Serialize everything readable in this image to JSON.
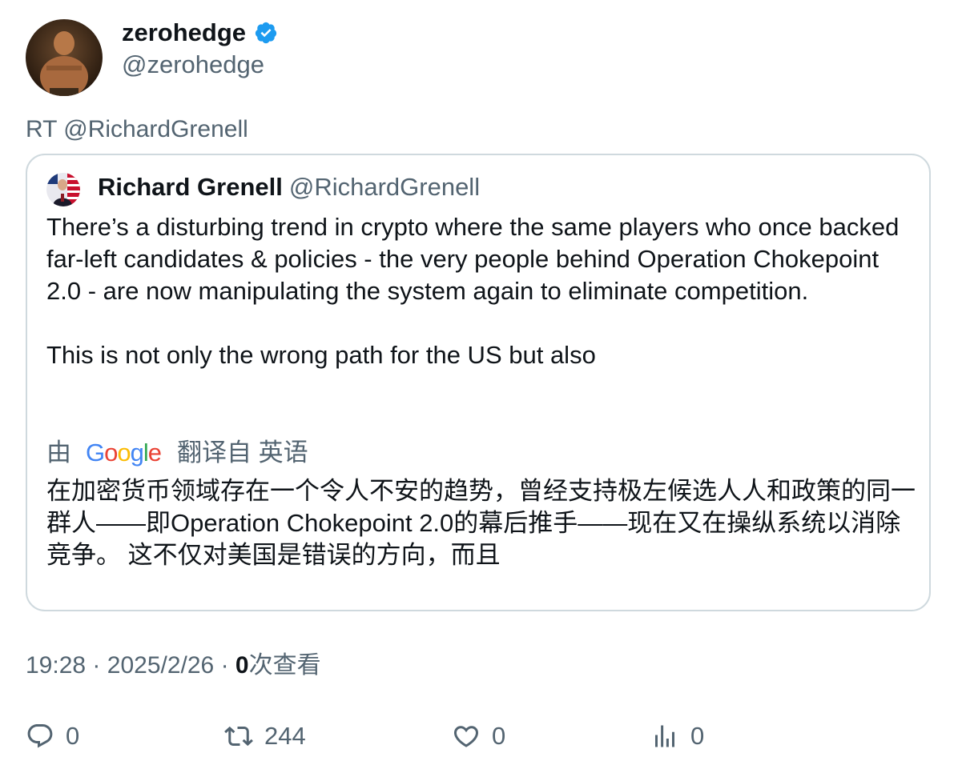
{
  "author": {
    "name": "zerohedge",
    "handle": "@zerohedge",
    "verified": true,
    "verified_color": "#1d9bf0"
  },
  "retweet_label": "RT @RichardGrenell",
  "quote": {
    "name": "Richard Grenell",
    "handle": "@RichardGrenell",
    "text_paragraph_1": "There’s a disturbing trend in crypto where the same players who once backed far-left candidates & policies - the very people behind Operation Chokepoint 2.0 - are now manipulating the system again to eliminate competition.",
    "text_paragraph_2": "This is not only the wrong path for the US but also",
    "translation": {
      "prefix": "由",
      "provider_logo": {
        "G": "G",
        "o1": "o",
        "o2": "o",
        "g": "g",
        "l": "l",
        "e": "e"
      },
      "suffix": "翻译自 英语",
      "text": "在加密货币领域存在一个令人不安的趋势，曾经支持极左候选人人和政策的同一群人——即Operation Chokepoint 2.0的幕后推手——现在又在操纵系统以消除竞争。 这不仅对美国是错误的方向，而且"
    }
  },
  "meta": {
    "time": "19:28",
    "separator": "·",
    "date": "2025/2/26",
    "views_count": "0",
    "views_label": "次查看"
  },
  "actions": {
    "reply": {
      "icon": "reply-icon",
      "count": "0"
    },
    "retweet": {
      "icon": "retweet-icon",
      "count": "244"
    },
    "like": {
      "icon": "heart-icon",
      "count": "0"
    },
    "views": {
      "icon": "analytics-icon",
      "count": "0"
    }
  },
  "colors": {
    "text_primary": "#0f1419",
    "text_secondary": "#536471",
    "border": "#cfd9de"
  }
}
